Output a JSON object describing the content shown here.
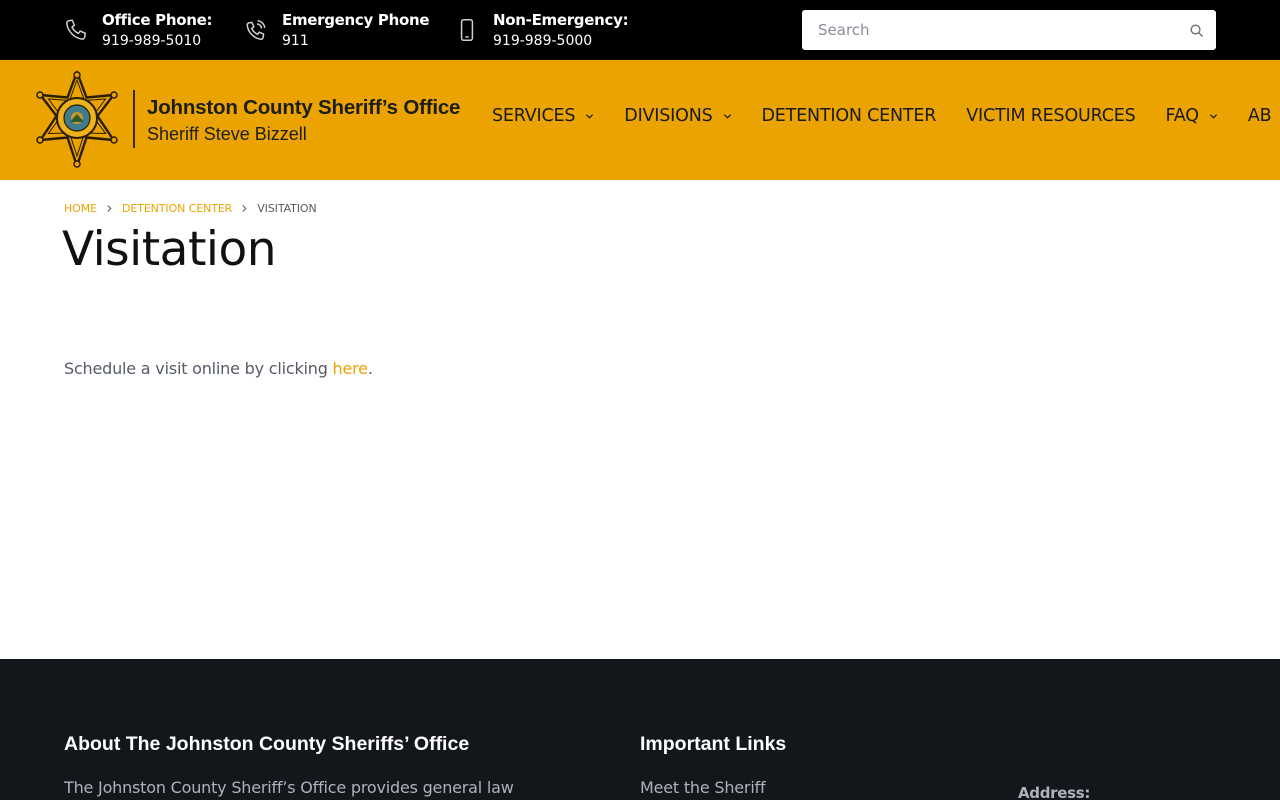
{
  "topbar": {
    "contacts": [
      {
        "label": "Office Phone:",
        "value": "919-989-5010",
        "icon": "phone-icon"
      },
      {
        "label": "Emergency Phone",
        "value": "911",
        "icon": "phone-ringing-icon"
      },
      {
        "label": "Non-Emergency:",
        "value": "919-989-5000",
        "icon": "mobile-phone-icon"
      }
    ],
    "search": {
      "placeholder": "Search",
      "value": "",
      "icon": "search-icon"
    }
  },
  "header": {
    "logo_title": "Johnston County Sheriff’s Office",
    "logo_subtitle": "Sheriff Steve Bizzell",
    "badge_text": "SHERIFF JOHNSTON COUNTY",
    "nav": [
      {
        "label": "SERVICES",
        "has_dropdown": true
      },
      {
        "label": "DIVISIONS",
        "has_dropdown": true
      },
      {
        "label": "DETENTION CENTER",
        "has_dropdown": false
      },
      {
        "label": "VICTIM RESOURCES",
        "has_dropdown": false
      },
      {
        "label": "FAQ",
        "has_dropdown": true
      },
      {
        "label": "AB",
        "has_dropdown": false
      }
    ]
  },
  "breadcrumb": {
    "home": "HOME",
    "parent": "DETENTION CENTER",
    "current": "VISITATION"
  },
  "page": {
    "title": "Visitation",
    "text_before": "Schedule a visit online by clicking ",
    "link": "here",
    "text_after": "."
  },
  "footer": {
    "about_heading": "About The Johnston County Sheriffs’ Office",
    "about_text": "The Johnston County Sheriff’s Office provides general law",
    "links_heading": "Important Links",
    "links": [
      "Meet the Sheriff"
    ],
    "address_label": "Address:"
  },
  "colors": {
    "brand_gold": "#eaa301",
    "topbar_bg": "#000000",
    "footer_bg": "#13161b",
    "text_muted": "#555c66"
  }
}
